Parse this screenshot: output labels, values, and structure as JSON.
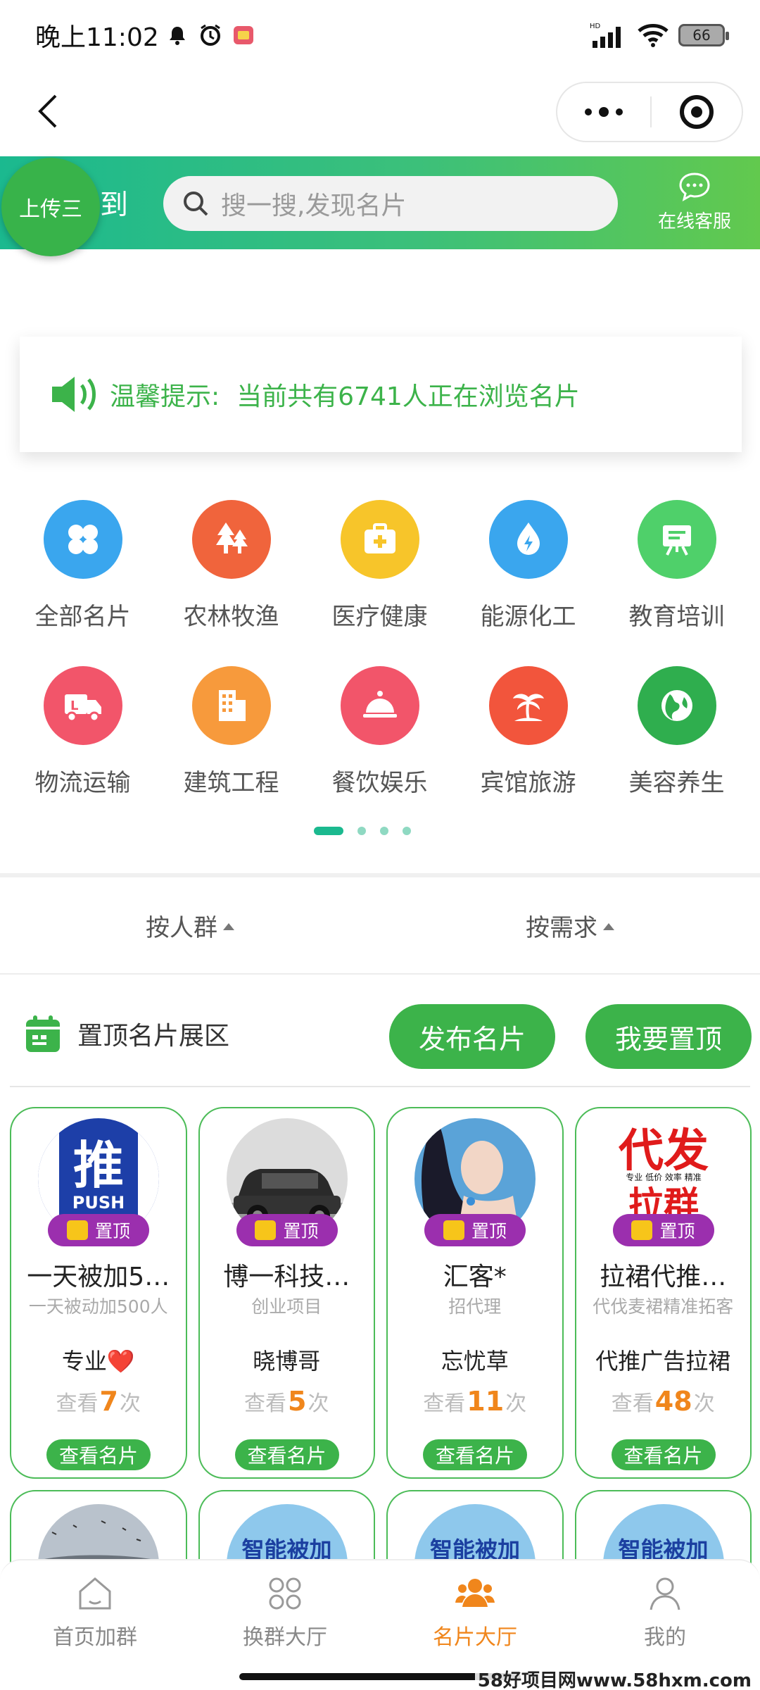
{
  "status_bar": {
    "time": "晚上11:02",
    "battery": "66",
    "network": "HD"
  },
  "header": {
    "signin_fragment": "到",
    "upload_label": "上传三",
    "search_placeholder": "搜一搜,发现名片",
    "service_label": "在线客服"
  },
  "notice": {
    "title": "温馨提示:",
    "text": "当前共有6741人正在浏览名片"
  },
  "categories": [
    {
      "label": "全部名片",
      "icon": "clover-icon",
      "color": "#3aa6ee"
    },
    {
      "label": "农林牧渔",
      "icon": "tree-icon",
      "color": "#f0643c"
    },
    {
      "label": "医疗健康",
      "icon": "medical-kit-icon",
      "color": "#f7c52a"
    },
    {
      "label": "能源化工",
      "icon": "energy-drop-icon",
      "color": "#3aa6ee"
    },
    {
      "label": "教育培训",
      "icon": "easel-icon",
      "color": "#4fd06a"
    },
    {
      "label": "物流运输",
      "icon": "truck-icon",
      "color": "#f2556a"
    },
    {
      "label": "建筑工程",
      "icon": "building-icon",
      "color": "#f79a3c"
    },
    {
      "label": "餐饮娱乐",
      "icon": "cloche-icon",
      "color": "#f2556a"
    },
    {
      "label": "宾馆旅游",
      "icon": "palm-tree-icon",
      "color": "#f2553c"
    },
    {
      "label": "美容养生",
      "icon": "globe-icon",
      "color": "#2fae4e"
    }
  ],
  "filters": [
    {
      "label": "按人群"
    },
    {
      "label": "按需求"
    }
  ],
  "pinned": {
    "title": "置顶名片展区",
    "publish_button": "发布名片",
    "top_button": "我要置顶"
  },
  "cards": [
    {
      "name": "一天被加5…",
      "desc": "一天被动加500人",
      "owner": "专业❤️",
      "views_prefix": "查看",
      "views": "7",
      "views_suffix": "次",
      "badge": "置顶",
      "button": "查看名片",
      "avatar_text_1": "推",
      "avatar_text_2": "PUSH"
    },
    {
      "name": "博一科技…",
      "desc": "创业项目",
      "owner": "晓博哥",
      "views_prefix": "查看",
      "views": "5",
      "views_suffix": "次",
      "badge": "置顶",
      "button": "查看名片"
    },
    {
      "name": "汇客*",
      "desc": "招代理",
      "owner": "忘忧草",
      "views_prefix": "查看",
      "views": "11",
      "views_suffix": "次",
      "badge": "置顶",
      "button": "查看名片"
    },
    {
      "name": "拉裙代推…",
      "desc": "代伐麦裙精准拓客",
      "owner": "代推广告拉裙",
      "views_prefix": "查看",
      "views": "48",
      "views_suffix": "次",
      "badge": "置顶",
      "button": "查看名片",
      "avatar_text_1": "代发",
      "avatar_text_2": "专业 低价 效率 精准",
      "avatar_text_3": "拉群"
    }
  ],
  "cards_row2": [
    {
      "text": ""
    },
    {
      "text": "智能被加"
    },
    {
      "text": "智能被加"
    },
    {
      "text": "智能被加"
    }
  ],
  "tabs": [
    {
      "label": "首页加群",
      "icon": "home-icon",
      "active": false
    },
    {
      "label": "换群大厅",
      "icon": "grid-circles-icon",
      "active": false
    },
    {
      "label": "名片大厅",
      "icon": "people-icon",
      "active": true
    },
    {
      "label": "我的",
      "icon": "person-icon",
      "active": false
    }
  ],
  "watermark": "58好项目网www.58hxm.com"
}
